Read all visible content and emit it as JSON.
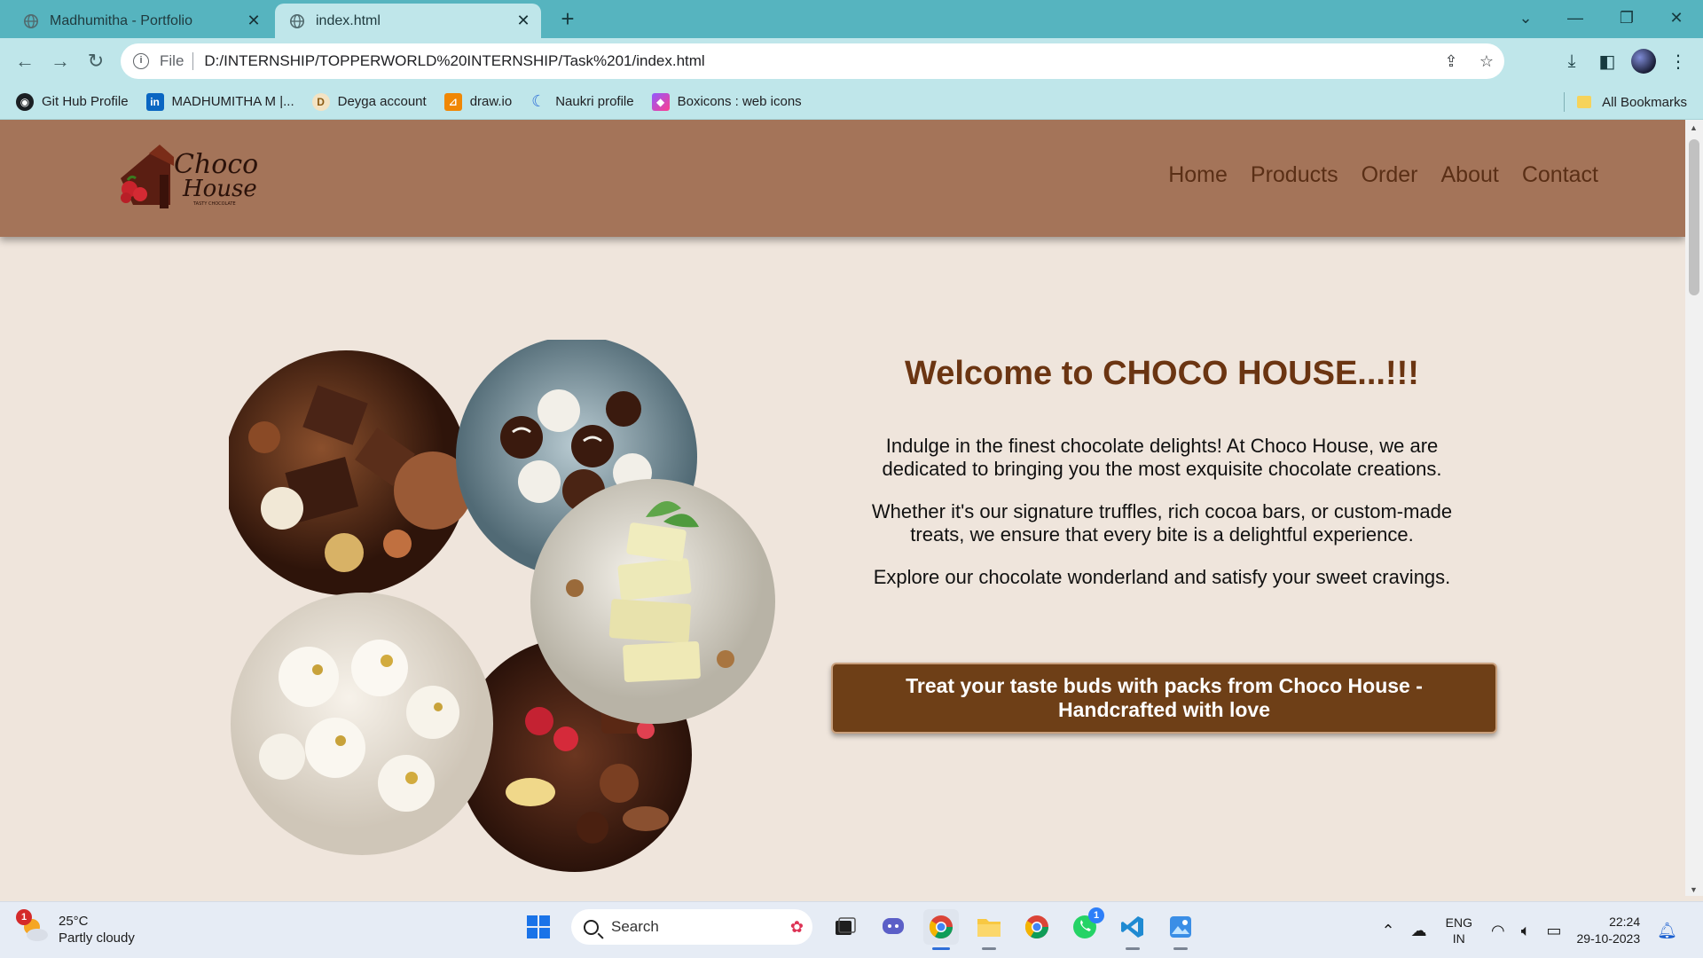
{
  "browser": {
    "tabs": [
      {
        "title": "Madhumitha - Portfolio",
        "active": false
      },
      {
        "title": "index.html",
        "active": true
      }
    ],
    "address": {
      "scheme_label": "File",
      "url": "D:/INTERNSHIP/TOPPERWORLD%20INTERNSHIP/Task%201/index.html"
    },
    "bookmarks": [
      {
        "label": "Git Hub Profile",
        "icon": "github-icon"
      },
      {
        "label": "MADHUMITHA M |...",
        "icon": "linkedin-icon"
      },
      {
        "label": "Deyga account",
        "icon": "deyga-icon"
      },
      {
        "label": "draw.io",
        "icon": "drawio-icon"
      },
      {
        "label": "Naukri profile",
        "icon": "naukri-icon"
      },
      {
        "label": "Boxicons : web icons",
        "icon": "boxicons-icon"
      }
    ],
    "all_bookmarks_label": "All Bookmarks"
  },
  "site": {
    "logo": {
      "line1": "Choco",
      "line2": "House",
      "tagline": "TASTY CHOCOLATE"
    },
    "nav": [
      "Home",
      "Products",
      "Order",
      "About",
      "Contact"
    ],
    "hero": {
      "title": "Welcome to CHOCO HOUSE...!!!",
      "paragraphs": [
        "Indulge in the finest chocolate delights! At Choco House, we are dedicated to bringing you the most exquisite chocolate creations.",
        "Whether it's our signature truffles, rich cocoa bars, or custom-made treats, we ensure that every bite is a delightful experience.",
        "Explore our chocolate wonderland and satisfy your sweet cravings."
      ],
      "cta": "Treat your taste buds with packs from Choco House - Handcrafted with love"
    },
    "colors": {
      "header": "#a47459",
      "page_bg": "#efe5dc",
      "accent": "#6b3512",
      "cta_bg": "#6e3f17"
    }
  },
  "taskbar": {
    "weather": {
      "temp": "25°C",
      "condition": "Partly cloudy",
      "badge": "1"
    },
    "search_label": "Search",
    "whatsapp_badge": "1",
    "language": {
      "line1": "ENG",
      "line2": "IN"
    },
    "clock": {
      "time": "22:24",
      "date": "29-10-2023"
    }
  }
}
